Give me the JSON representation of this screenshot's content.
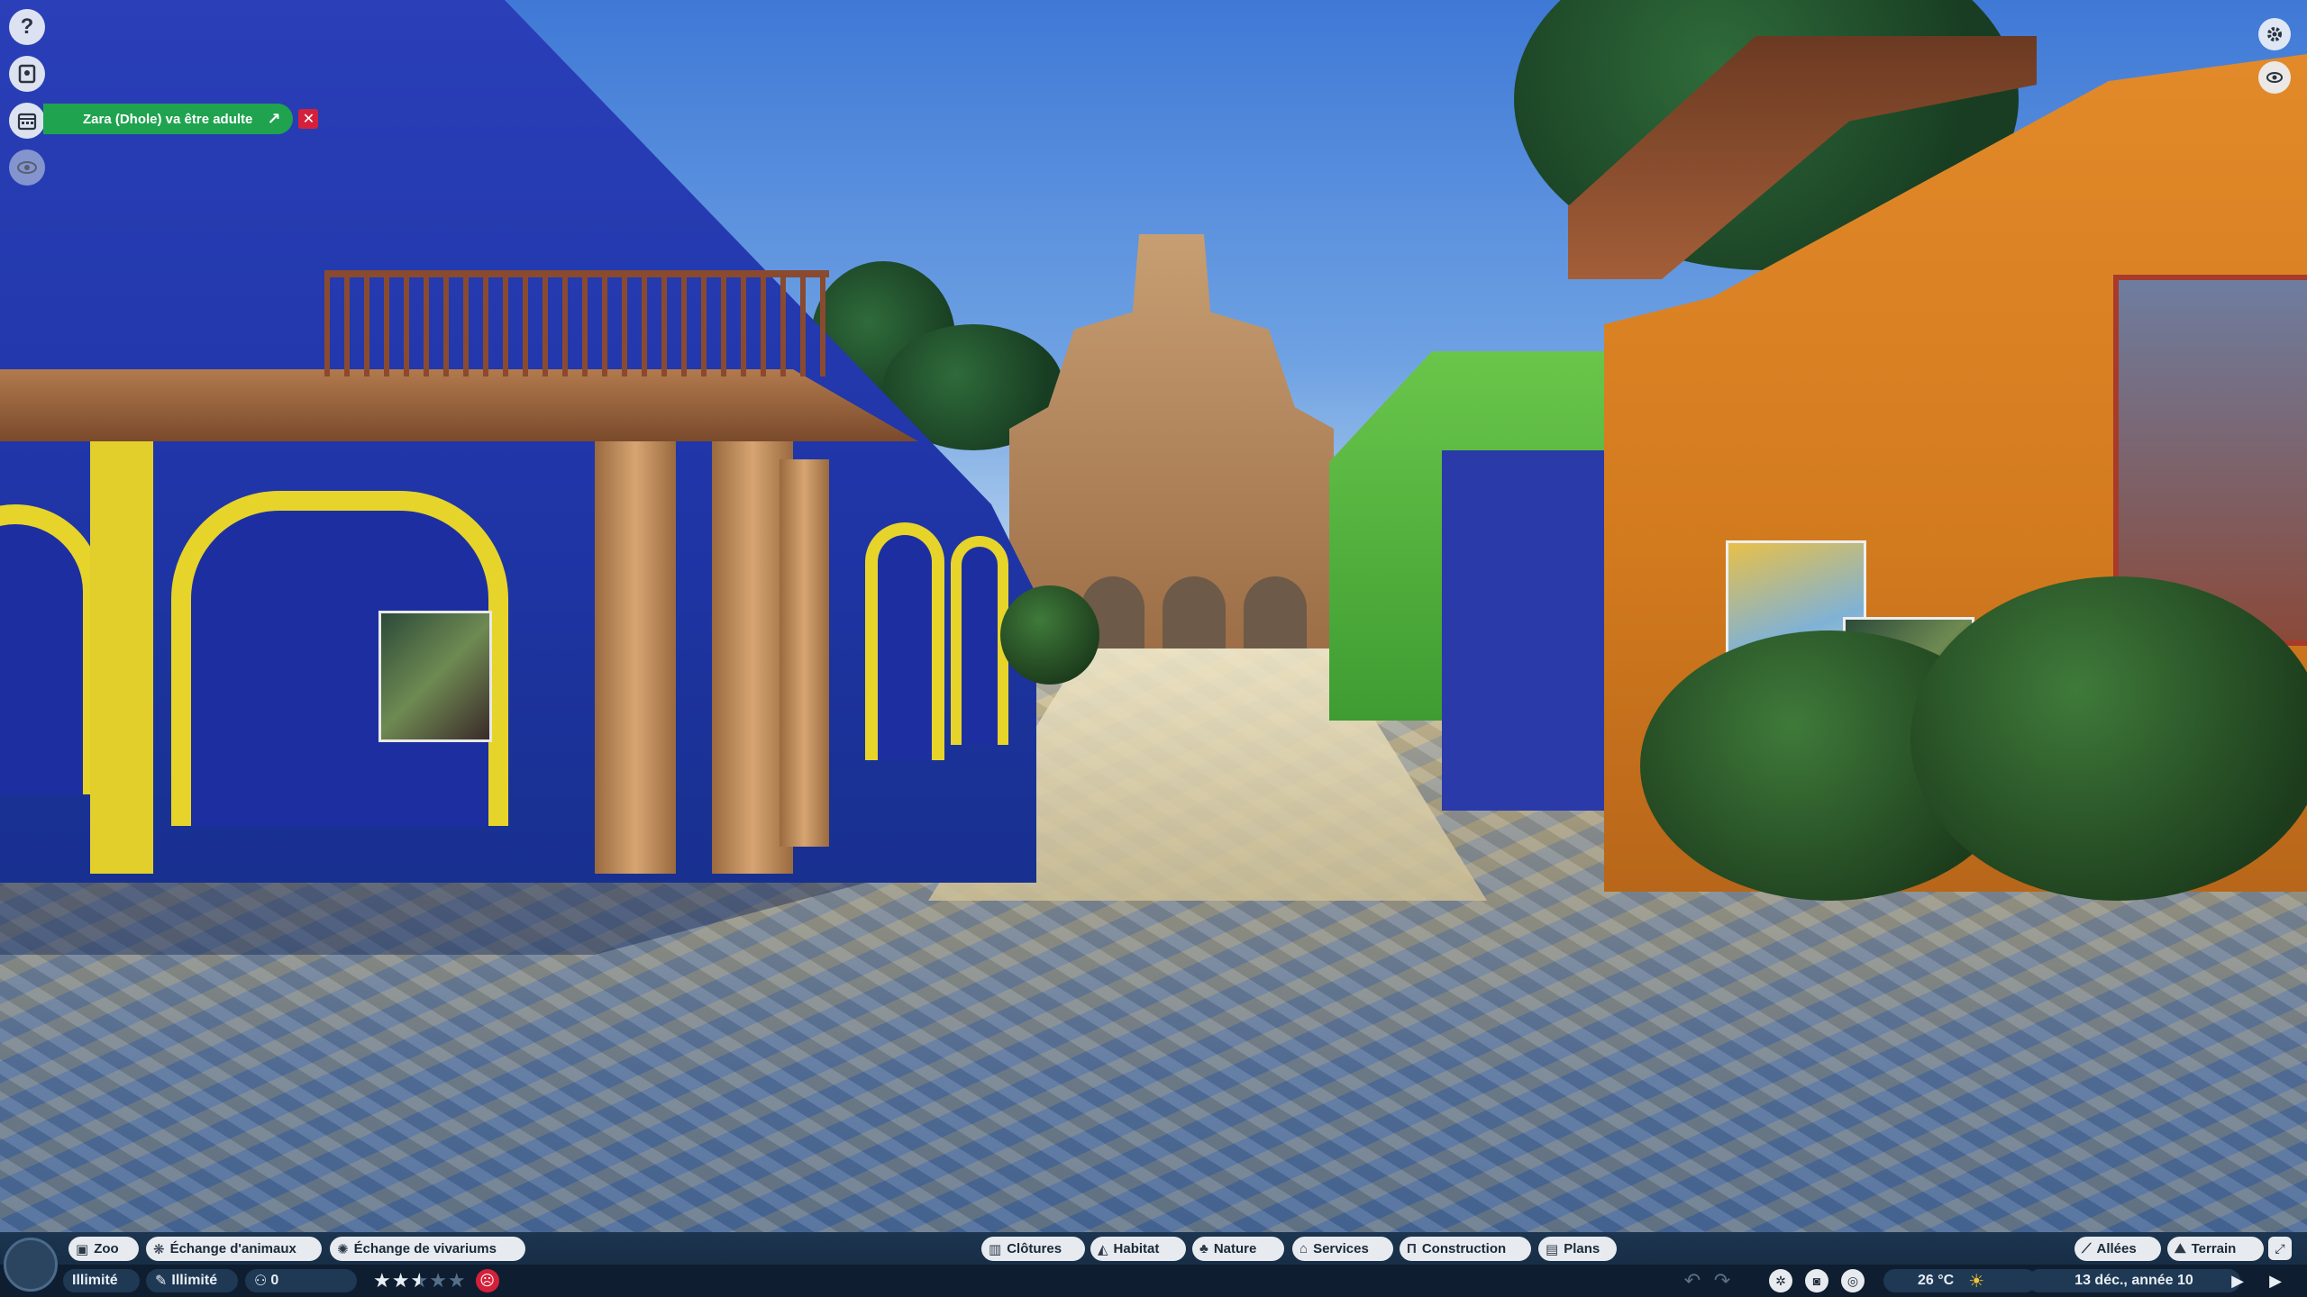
{
  "notification": {
    "text": "Zara (Dhole) va être adulte"
  },
  "left_toolbar": {
    "help_glyph": "?"
  },
  "bottom_left_tabs": [
    {
      "label": "Zoo",
      "icon": "zoo-icon"
    },
    {
      "label": "Échange d'animaux",
      "icon": "paw-icon"
    },
    {
      "label": "Échange de vivariums",
      "icon": "bug-icon"
    }
  ],
  "bottom_center_tabs": [
    {
      "label": "Clôtures",
      "icon": "fence-icon"
    },
    {
      "label": "Habitat",
      "icon": "habitat-icon"
    },
    {
      "label": "Nature",
      "icon": "tree-icon"
    },
    {
      "label": "Services",
      "icon": "shop-icon"
    },
    {
      "label": "Construction",
      "icon": "pillar-icon"
    },
    {
      "label": "Plans",
      "icon": "blueprint-icon"
    }
  ],
  "bottom_right_tabs": [
    {
      "label": "Allées",
      "icon": "path-icon"
    },
    {
      "label": "Terrain",
      "icon": "terrain-icon"
    }
  ],
  "status": {
    "money": "Illimité",
    "research": "Illimité",
    "guests": "0",
    "rating_stars": 2.5,
    "rating_max": 5,
    "temperature": "26 °C",
    "date": "13 déc., année 10"
  },
  "colors": {
    "notification": "#1fa34f",
    "close": "#d4203a",
    "bar": "#1c3550"
  }
}
